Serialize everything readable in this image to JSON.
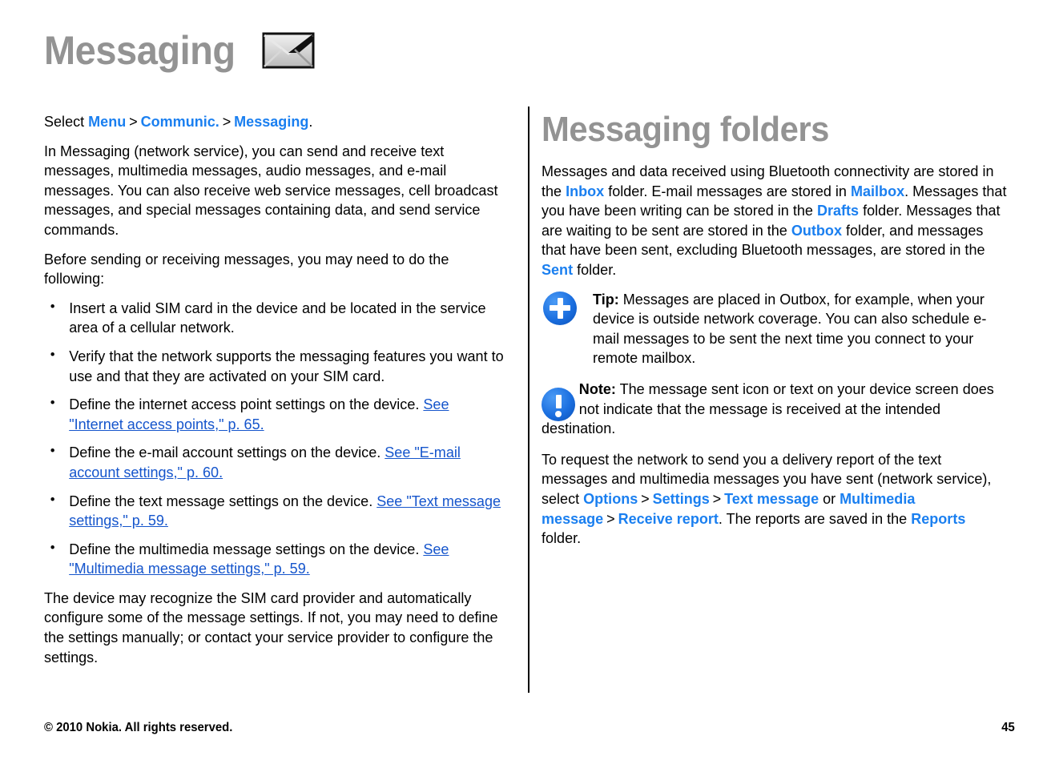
{
  "header": {
    "title": "Messaging",
    "icon": "envelope-icon"
  },
  "left_column": {
    "select_path": {
      "prefix": "Select ",
      "terms": [
        "Menu",
        "Communic.",
        "Messaging"
      ],
      "separator": ">",
      "suffix": "."
    },
    "intro_paragraph": "In Messaging (network service), you can send and receive text messages, multimedia messages, audio messages, and e-mail messages. You can also receive web service messages, cell broadcast messages, and special messages containing data, and send service commands.",
    "before_sending_paragraph": "Before sending or receiving messages, you may need to do the following:",
    "bullets": [
      {
        "text": "Insert a valid SIM card in the device and be located in the service area of a cellular network.",
        "link": ""
      },
      {
        "text": "Verify that the network supports the messaging features you want to use and that they are activated on your SIM card.",
        "link": ""
      },
      {
        "text": "Define the internet access point settings on the device. ",
        "link": "See \"Internet access points,\" p. 65."
      },
      {
        "text": "Define the e-mail account settings on the device. ",
        "link": "See \"E-mail account settings,\" p. 60."
      },
      {
        "text": "Define the text message settings on the device. ",
        "link": "See \"Text message settings,\" p. 59."
      },
      {
        "text": "Define the multimedia message settings on the device. ",
        "link": "See \"Multimedia message settings,\" p. 59."
      }
    ],
    "closing_paragraph": "The device may recognize the SIM card provider and automatically configure some of the message settings. If not, you may need to define the settings manually; or contact your service provider to configure the settings."
  },
  "right_column": {
    "heading": "Messaging folders",
    "folders_paragraph": {
      "p1": "Messages and data received using Bluetooth connectivity are stored in the ",
      "inbox": "Inbox",
      "p2": " folder. E-mail messages are stored in ",
      "mailbox": "Mailbox",
      "p3": ". Messages that you have been writing can be stored in the ",
      "drafts": "Drafts",
      "p4": " folder. Messages that are waiting to be sent are stored in the ",
      "outbox": "Outbox",
      "p5": " folder, and messages that have been sent, excluding Bluetooth messages, are stored in the ",
      "sent": "Sent",
      "p6": " folder."
    },
    "tip": {
      "icon": "tip-plus-icon",
      "label": "Tip:",
      "text": " Messages are placed in Outbox, for example, when your device is outside network coverage. You can also schedule e-mail messages to be sent the next time you connect to your remote mailbox."
    },
    "note": {
      "icon": "note-exclamation-icon",
      "label": "Note:",
      "text": "  The message sent icon or text on your device screen does not indicate that the message is received at the intended destination."
    },
    "delivery_paragraph": {
      "p1": "To request the network to send you a delivery report of the text messages and multimedia messages you have sent (network service), select ",
      "options": "Options",
      "sep1": ">",
      "settings": "Settings",
      "sep2": ">",
      "text_message": "Text message",
      "or": " or ",
      "multimedia_message": "Multimedia message",
      "sep3": ">",
      "receive_report": "Receive report",
      "p2": ". The reports are saved in the ",
      "reports": "Reports",
      "p3": " folder."
    }
  },
  "footer": {
    "copyright": "© 2010 Nokia. All rights reserved.",
    "page_number": "45"
  },
  "colors": {
    "ui_term_blue": "#1a7ff0",
    "link_blue": "#1555cc",
    "heading_gray": "#939393"
  }
}
